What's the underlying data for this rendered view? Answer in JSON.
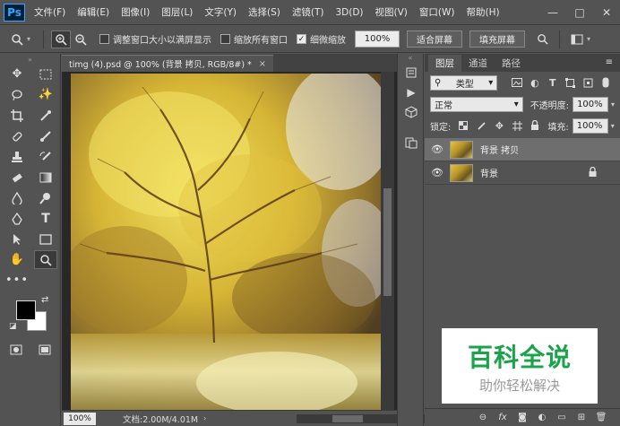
{
  "app": {
    "logo": "Ps"
  },
  "menu": [
    "文件(F)",
    "编辑(E)",
    "图像(I)",
    "图层(L)",
    "文字(Y)",
    "选择(S)",
    "滤镜(T)",
    "3D(D)",
    "视图(V)",
    "窗口(W)",
    "帮助(H)"
  ],
  "window_controls": {
    "minimize": "—",
    "maximize": "□",
    "close": "✕"
  },
  "options": {
    "resize_windows": "调整窗口大小以满屏显示",
    "zoom_all_windows": "缩放所有窗口",
    "scrubby_zoom": "细微缩放",
    "zoom_value": "100%",
    "fit_screen": "适合屏幕",
    "fill_screen": "填充屏幕"
  },
  "document": {
    "tab_title": "timg (4).psd @ 100% (背景 拷贝, RGB/8#) *",
    "tab_close": "×",
    "status_zoom": "100%",
    "status_info": "文档:2.00M/4.01M"
  },
  "panel": {
    "tabs": [
      "图层",
      "通道",
      "路径"
    ],
    "filter_kind": "类型",
    "blend_mode": "正常",
    "opacity_label": "不透明度:",
    "opacity_value": "100%",
    "lock_label": "锁定:",
    "fill_label": "填充:",
    "fill_value": "100%",
    "layers": [
      {
        "name": "背景 拷贝",
        "selected": true,
        "locked": false
      },
      {
        "name": "背景",
        "selected": false,
        "locked": true
      }
    ]
  },
  "watermark": {
    "title": "百科全说",
    "subtitle": "助你轻松解决"
  }
}
